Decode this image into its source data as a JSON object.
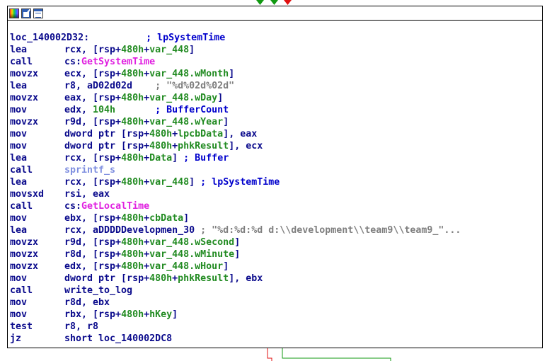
{
  "colors": {
    "mnemonic": "#0a0a8c",
    "number": "#228b22",
    "import_name": "#e020e0",
    "subroutine": "#7f8fe0",
    "comment": "#0000cc",
    "string_comment": "#7f7f7f",
    "edge_true": "#119911",
    "edge_false": "#e01010"
  },
  "header_icons": [
    "color-picker-icon",
    "rename-icon",
    "graph-icon"
  ],
  "label_line": {
    "label": "loc_140002D32:",
    "comment": "; lpSystemTime"
  },
  "lines": [
    {
      "mn": "lea",
      "p": [
        {
          "t": "rcx, [rsp+"
        },
        {
          "t": "480h",
          "c": "num"
        },
        {
          "t": "+"
        },
        {
          "t": "var_448",
          "c": "var"
        },
        {
          "t": "]"
        }
      ]
    },
    {
      "mn": "call",
      "p": [
        {
          "t": "cs:"
        },
        {
          "t": "GetSystemTime",
          "c": "fn"
        }
      ]
    },
    {
      "mn": "movzx",
      "p": [
        {
          "t": "ecx, [rsp+"
        },
        {
          "t": "480h",
          "c": "num"
        },
        {
          "t": "+"
        },
        {
          "t": "var_448.wMonth",
          "c": "var"
        },
        {
          "t": "]"
        }
      ]
    },
    {
      "mn": "lea",
      "p": [
        {
          "t": "r8, aD02d02d    "
        },
        {
          "t": "; \"%d%02d%02d\"",
          "c": "str"
        }
      ]
    },
    {
      "mn": "movzx",
      "p": [
        {
          "t": "eax, [rsp+"
        },
        {
          "t": "480h",
          "c": "num"
        },
        {
          "t": "+"
        },
        {
          "t": "var_448.wDay",
          "c": "var"
        },
        {
          "t": "]"
        }
      ]
    },
    {
      "mn": "mov",
      "p": [
        {
          "t": "edx, "
        },
        {
          "t": "104h",
          "c": "num"
        },
        {
          "t": "       "
        },
        {
          "t": "; BufferCount",
          "c": "cmt"
        }
      ]
    },
    {
      "mn": "movzx",
      "p": [
        {
          "t": "r9d, [rsp+"
        },
        {
          "t": "480h",
          "c": "num"
        },
        {
          "t": "+"
        },
        {
          "t": "var_448.wYear",
          "c": "var"
        },
        {
          "t": "]"
        }
      ]
    },
    {
      "mn": "mov",
      "p": [
        {
          "t": "dword ptr [rsp+"
        },
        {
          "t": "480h",
          "c": "num"
        },
        {
          "t": "+"
        },
        {
          "t": "lpcbData",
          "c": "var"
        },
        {
          "t": "], eax"
        }
      ]
    },
    {
      "mn": "mov",
      "p": [
        {
          "t": "dword ptr [rsp+"
        },
        {
          "t": "480h",
          "c": "num"
        },
        {
          "t": "+"
        },
        {
          "t": "phkResult",
          "c": "var"
        },
        {
          "t": "], ecx"
        }
      ]
    },
    {
      "mn": "lea",
      "p": [
        {
          "t": "rcx, [rsp+"
        },
        {
          "t": "480h",
          "c": "num"
        },
        {
          "t": "+"
        },
        {
          "t": "Data",
          "c": "var"
        },
        {
          "t": "] "
        },
        {
          "t": "; Buffer",
          "c": "cmt"
        }
      ]
    },
    {
      "mn": "call",
      "p": [
        {
          "t": "sprintf_s",
          "c": "sub"
        }
      ]
    },
    {
      "mn": "lea",
      "p": [
        {
          "t": "rcx, [rsp+"
        },
        {
          "t": "480h",
          "c": "num"
        },
        {
          "t": "+"
        },
        {
          "t": "var_448",
          "c": "var"
        },
        {
          "t": "] "
        },
        {
          "t": "; lpSystemTime",
          "c": "cmt"
        }
      ]
    },
    {
      "mn": "movsxd",
      "p": [
        {
          "t": "rsi, eax"
        }
      ]
    },
    {
      "mn": "call",
      "p": [
        {
          "t": "cs:"
        },
        {
          "t": "GetLocalTime",
          "c": "fn"
        }
      ]
    },
    {
      "mn": "mov",
      "p": [
        {
          "t": "ebx, [rsp+"
        },
        {
          "t": "480h",
          "c": "num"
        },
        {
          "t": "+"
        },
        {
          "t": "cbData",
          "c": "var"
        },
        {
          "t": "]"
        }
      ]
    },
    {
      "mn": "lea",
      "p": [
        {
          "t": "rcx, aDDDDDevelopmen_30 "
        },
        {
          "t": "; \"%d:%d:%d d:\\\\development\\\\team9\\\\team9_\"...",
          "c": "str"
        }
      ]
    },
    {
      "mn": "movzx",
      "p": [
        {
          "t": "r9d, [rsp+"
        },
        {
          "t": "480h",
          "c": "num"
        },
        {
          "t": "+"
        },
        {
          "t": "var_448.wSecond",
          "c": "var"
        },
        {
          "t": "]"
        }
      ]
    },
    {
      "mn": "movzx",
      "p": [
        {
          "t": "r8d, [rsp+"
        },
        {
          "t": "480h",
          "c": "num"
        },
        {
          "t": "+"
        },
        {
          "t": "var_448.wMinute",
          "c": "var"
        },
        {
          "t": "]"
        }
      ]
    },
    {
      "mn": "movzx",
      "p": [
        {
          "t": "edx, [rsp+"
        },
        {
          "t": "480h",
          "c": "num"
        },
        {
          "t": "+"
        },
        {
          "t": "var_448.wHour",
          "c": "var"
        },
        {
          "t": "]"
        }
      ]
    },
    {
      "mn": "mov",
      "p": [
        {
          "t": "dword ptr [rsp+"
        },
        {
          "t": "480h",
          "c": "num"
        },
        {
          "t": "+"
        },
        {
          "t": "phkResult",
          "c": "var"
        },
        {
          "t": "], ebx"
        }
      ]
    },
    {
      "mn": "call",
      "p": [
        {
          "t": "write_to_log"
        }
      ]
    },
    {
      "mn": "mov",
      "p": [
        {
          "t": "r8d, ebx"
        }
      ]
    },
    {
      "mn": "mov",
      "p": [
        {
          "t": "rbx, [rsp+"
        },
        {
          "t": "480h",
          "c": "num"
        },
        {
          "t": "+"
        },
        {
          "t": "hKey",
          "c": "var"
        },
        {
          "t": "]"
        }
      ]
    },
    {
      "mn": "test",
      "p": [
        {
          "t": "r8, r8"
        }
      ]
    },
    {
      "mn": "jz",
      "p": [
        {
          "t": "short loc_140002DC8"
        }
      ]
    }
  ]
}
